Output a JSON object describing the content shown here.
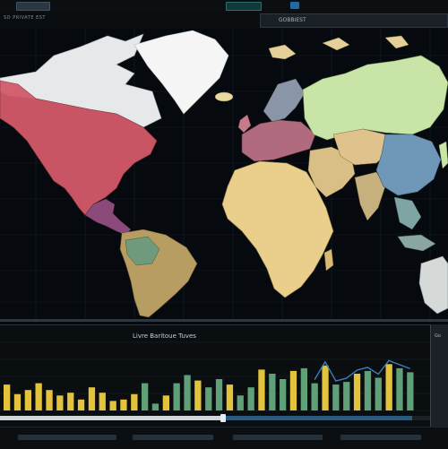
{
  "header": {
    "left_label": "SO PRIVATE EST",
    "right_panel_label": "GOBBIEST"
  },
  "chart_panel": {
    "title": "Livre Baritoue Tuves",
    "side_label": "Go"
  },
  "colors": {
    "background": "#07090b",
    "ocean": "#06090d",
    "north_america": "#d55a6a",
    "greenland": "#f2f3f1",
    "africa": "#e8cf8a",
    "russia": "#c7e4a6",
    "europe": "#b26a7c",
    "south_america": "#b9a06a",
    "bar_yellow": "#e2c33b",
    "bar_green": "#5fa079",
    "accent_blue": "#2b5a7a"
  },
  "chart_data": {
    "type": "bar",
    "values": [
      0.38,
      0.24,
      0.3,
      0.4,
      0.3,
      0.22,
      0.26,
      0.16,
      0.34,
      0.26,
      0.14,
      0.16,
      0.24,
      0.4,
      0.1,
      0.22,
      0.4,
      0.52,
      0.44,
      0.34,
      0.46,
      0.38,
      0.22,
      0.34,
      0.6,
      0.54,
      0.46,
      0.58,
      0.62,
      0.4,
      0.66,
      0.38,
      0.42,
      0.54,
      0.58,
      0.48,
      0.68,
      0.62,
      0.56
    ]
  }
}
